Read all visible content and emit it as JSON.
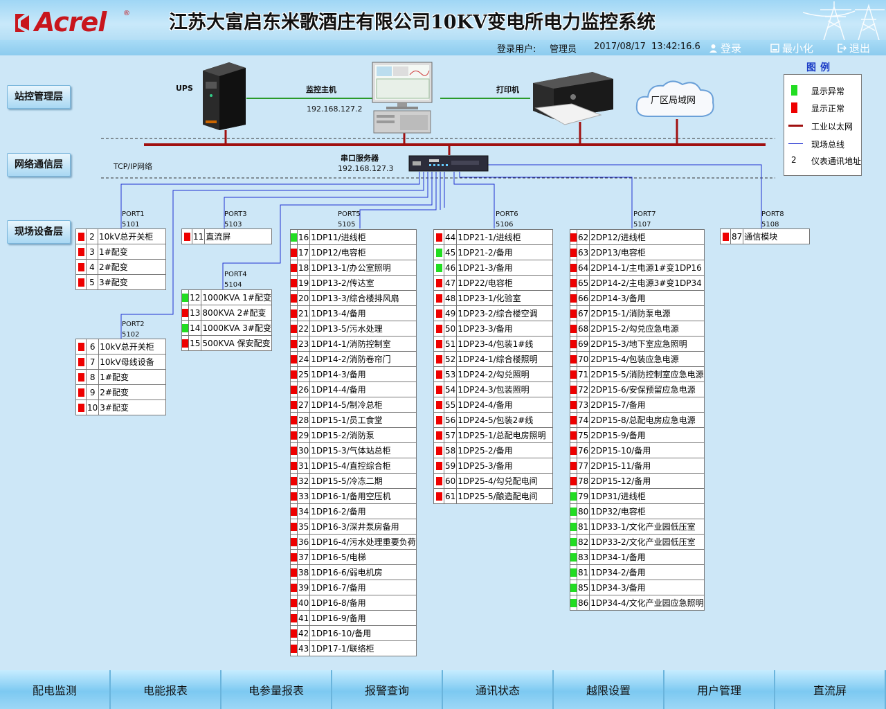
{
  "header": {
    "logo_text": "Acrel",
    "title": "江苏大富启东米歌酒庄有限公司10KV变电所电力监控系统"
  },
  "statusbar": {
    "user_label": "登录用户:",
    "user": "管理员",
    "date": "2017/08/17",
    "time": "13:42:16.6",
    "login": "登录",
    "minimize": "最小化",
    "logout": "退出"
  },
  "layers": {
    "station": "站控管理层",
    "network": "网络通信层",
    "field": "现场设备层"
  },
  "devices": {
    "ups": "UPS",
    "host": "监控主机",
    "host_ip": "192.168.127.2",
    "printer": "打印机",
    "lan": "厂区局域网",
    "server": "串口服务器",
    "server_ip": "192.168.127.3",
    "tcpip": "TCP/IP网络"
  },
  "legend": {
    "title": "图例",
    "items": [
      {
        "label": "显示异常",
        "color": "#22dd22"
      },
      {
        "label": "显示正常",
        "color": "#ee0000"
      },
      {
        "label": "工业以太网",
        "color": "#a01010"
      },
      {
        "label": "现场总线",
        "color": "#2030d0"
      },
      {
        "label": "仪表通讯地址",
        "marker": "2"
      }
    ]
  },
  "ports": {
    "p1": {
      "name": "PORT1",
      "num": "5101"
    },
    "p2": {
      "name": "PORT2",
      "num": "5102"
    },
    "p3": {
      "name": "PORT3",
      "num": "5103"
    },
    "p4": {
      "name": "PORT4",
      "num": "5104"
    },
    "p5": {
      "name": "PORT5",
      "num": "5105"
    },
    "p6": {
      "name": "PORT6",
      "num": "5106"
    },
    "p7": {
      "name": "PORT7",
      "num": "5107"
    },
    "p8": {
      "name": "PORT8",
      "num": "5108"
    }
  },
  "tables": {
    "t1": [
      {
        "s": "red",
        "n": "2",
        "t": "10kV总开关柜"
      },
      {
        "s": "red",
        "n": "3",
        "t": "1#配变"
      },
      {
        "s": "red",
        "n": "4",
        "t": "2#配变"
      },
      {
        "s": "red",
        "n": "5",
        "t": "3#配变"
      }
    ],
    "t2": [
      {
        "s": "red",
        "n": "6",
        "t": "10kV总开关柜"
      },
      {
        "s": "red",
        "n": "7",
        "t": "10kV母线设备"
      },
      {
        "s": "red",
        "n": "8",
        "t": "1#配变"
      },
      {
        "s": "red",
        "n": "9",
        "t": "2#配变"
      },
      {
        "s": "red",
        "n": "10",
        "t": "3#配变"
      }
    ],
    "t3": [
      {
        "s": "red",
        "n": "11",
        "t": "直流屏"
      }
    ],
    "t4": [
      {
        "s": "green",
        "n": "12",
        "t": "1000KVA 1#配变"
      },
      {
        "s": "red",
        "n": "13",
        "t": "800KVA 2#配变"
      },
      {
        "s": "green",
        "n": "14",
        "t": "1000KVA 3#配变"
      },
      {
        "s": "red",
        "n": "15",
        "t": "500KVA 保安配变"
      }
    ],
    "t5": [
      {
        "s": "green",
        "n": "16",
        "t": "1DP11/进线柜"
      },
      {
        "s": "red",
        "n": "17",
        "t": "1DP12/电容柜"
      },
      {
        "s": "red",
        "n": "18",
        "t": "1DP13-1/办公室照明"
      },
      {
        "s": "red",
        "n": "19",
        "t": "1DP13-2/传达室"
      },
      {
        "s": "red",
        "n": "20",
        "t": "1DP13-3/综合楼排风扇"
      },
      {
        "s": "red",
        "n": "21",
        "t": "1DP13-4/备用"
      },
      {
        "s": "red",
        "n": "22",
        "t": "1DP13-5/污水处理"
      },
      {
        "s": "red",
        "n": "23",
        "t": "1DP14-1/消防控制室"
      },
      {
        "s": "red",
        "n": "24",
        "t": "1DP14-2/消防卷帘门"
      },
      {
        "s": "red",
        "n": "25",
        "t": "1DP14-3/备用"
      },
      {
        "s": "red",
        "n": "26",
        "t": "1DP14-4/备用"
      },
      {
        "s": "red",
        "n": "27",
        "t": "1DP14-5/制冷总柜"
      },
      {
        "s": "red",
        "n": "28",
        "t": "1DP15-1/员工食堂"
      },
      {
        "s": "red",
        "n": "29",
        "t": "1DP15-2/消防泵"
      },
      {
        "s": "red",
        "n": "30",
        "t": "1DP15-3/气体站总柜"
      },
      {
        "s": "red",
        "n": "31",
        "t": "1DP15-4/直控综合柜"
      },
      {
        "s": "red",
        "n": "32",
        "t": "1DP15-5/冷冻二期"
      },
      {
        "s": "red",
        "n": "33",
        "t": "1DP16-1/备用空压机"
      },
      {
        "s": "red",
        "n": "34",
        "t": "1DP16-2/备用"
      },
      {
        "s": "red",
        "n": "35",
        "t": "1DP16-3/深井泵房备用"
      },
      {
        "s": "red",
        "n": "36",
        "t": "1DP16-4/污水处理重要负荷"
      },
      {
        "s": "red",
        "n": "37",
        "t": "1DP16-5/电梯"
      },
      {
        "s": "red",
        "n": "38",
        "t": "1DP16-6/弱电机房"
      },
      {
        "s": "red",
        "n": "39",
        "t": "1DP16-7/备用"
      },
      {
        "s": "red",
        "n": "40",
        "t": "1DP16-8/备用"
      },
      {
        "s": "red",
        "n": "41",
        "t": "1DP16-9/备用"
      },
      {
        "s": "red",
        "n": "42",
        "t": "1DP16-10/备用"
      },
      {
        "s": "red",
        "n": "43",
        "t": "1DP17-1/联络柜"
      }
    ],
    "t6": [
      {
        "s": "red",
        "n": "44",
        "t": "1DP21-1/进线柜"
      },
      {
        "s": "green",
        "n": "45",
        "t": "1DP21-2/备用"
      },
      {
        "s": "green",
        "n": "46",
        "t": "1DP21-3/备用"
      },
      {
        "s": "red",
        "n": "47",
        "t": "1DP22/电容柜"
      },
      {
        "s": "red",
        "n": "48",
        "t": "1DP23-1/化验室"
      },
      {
        "s": "red",
        "n": "49",
        "t": "1DP23-2/综合楼空调"
      },
      {
        "s": "red",
        "n": "50",
        "t": "1DP23-3/备用"
      },
      {
        "s": "red",
        "n": "51",
        "t": "1DP23-4/包装1#线"
      },
      {
        "s": "red",
        "n": "52",
        "t": "1DP24-1/综合楼照明"
      },
      {
        "s": "red",
        "n": "53",
        "t": "1DP24-2/勾兑照明"
      },
      {
        "s": "red",
        "n": "54",
        "t": "1DP24-3/包装照明"
      },
      {
        "s": "red",
        "n": "55",
        "t": "1DP24-4/备用"
      },
      {
        "s": "red",
        "n": "56",
        "t": "1DP24-5/包装2#线"
      },
      {
        "s": "red",
        "n": "57",
        "t": "1DP25-1/总配电房照明"
      },
      {
        "s": "red",
        "n": "58",
        "t": "1DP25-2/备用"
      },
      {
        "s": "red",
        "n": "59",
        "t": "1DP25-3/备用"
      },
      {
        "s": "red",
        "n": "60",
        "t": "1DP25-4/勾兑配电间"
      },
      {
        "s": "red",
        "n": "61",
        "t": "1DP25-5/酿造配电间"
      }
    ],
    "t7": [
      {
        "s": "red",
        "n": "62",
        "t": "2DP12/进线柜"
      },
      {
        "s": "red",
        "n": "63",
        "t": "2DP13/电容柜"
      },
      {
        "s": "red",
        "n": "64",
        "t": "2DP14-1/主电源1#变1DP16"
      },
      {
        "s": "red",
        "n": "65",
        "t": "2DP14-2/主电源3#变1DP34"
      },
      {
        "s": "red",
        "n": "66",
        "t": "2DP14-3/备用"
      },
      {
        "s": "red",
        "n": "67",
        "t": "2DP15-1/消防泵电源"
      },
      {
        "s": "red",
        "n": "68",
        "t": "2DP15-2/勾兑应急电源"
      },
      {
        "s": "red",
        "n": "69",
        "t": "2DP15-3/地下室应急照明"
      },
      {
        "s": "red",
        "n": "70",
        "t": "2DP15-4/包装应急电源"
      },
      {
        "s": "red",
        "n": "71",
        "t": "2DP15-5/消防控制室应急电源"
      },
      {
        "s": "red",
        "n": "72",
        "t": "2DP15-6/安保预留应急电源"
      },
      {
        "s": "red",
        "n": "73",
        "t": "2DP15-7/备用"
      },
      {
        "s": "red",
        "n": "74",
        "t": "2DP15-8/总配电房应急电源"
      },
      {
        "s": "red",
        "n": "75",
        "t": "2DP15-9/备用"
      },
      {
        "s": "red",
        "n": "76",
        "t": "2DP15-10/备用"
      },
      {
        "s": "red",
        "n": "77",
        "t": "2DP15-11/备用"
      },
      {
        "s": "red",
        "n": "78",
        "t": "2DP15-12/备用"
      },
      {
        "s": "green",
        "n": "79",
        "t": "1DP31/进线柜"
      },
      {
        "s": "green",
        "n": "80",
        "t": "1DP32/电容柜"
      },
      {
        "s": "green",
        "n": "81",
        "t": "1DP33-1/文化产业园低压室"
      },
      {
        "s": "green",
        "n": "82",
        "t": "1DP33-2/文化产业园低压室"
      },
      {
        "s": "green",
        "n": "83",
        "t": "1DP34-1/备用"
      },
      {
        "s": "green",
        "n": "81",
        "t": "1DP34-2/备用"
      },
      {
        "s": "green",
        "n": "85",
        "t": "1DP34-3/备用"
      },
      {
        "s": "green",
        "n": "86",
        "t": "1DP34-4/文化产业园应急照明"
      }
    ],
    "t8": [
      {
        "s": "red",
        "n": "87",
        "t": "通信模块"
      }
    ]
  },
  "nav": [
    "配电监测",
    "电能报表",
    "电参量报表",
    "报警查询",
    "通讯状态",
    "越限设置",
    "用户管理",
    "直流屏"
  ],
  "colors": {
    "ethernet": "#a01010",
    "fieldbus": "#2030d0",
    "link": "#2a9a2a",
    "alarm_green": "#22dd22",
    "normal_red": "#ee0000"
  }
}
